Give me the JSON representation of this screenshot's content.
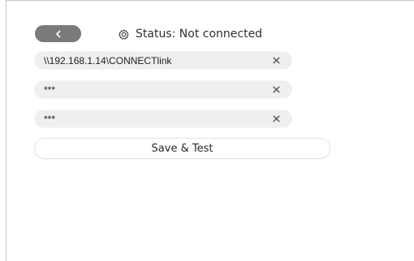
{
  "header": {
    "back_icon": "chevron-left-icon",
    "status_icon": "gear-icon",
    "status_text": "Status: Not connected"
  },
  "fields": [
    {
      "value": "\\\\192.168.1.14\\CONNECTlink",
      "clear_icon": "close-icon"
    },
    {
      "value": "***",
      "clear_icon": "close-icon"
    },
    {
      "value": "***",
      "clear_icon": "close-icon"
    }
  ],
  "actions": {
    "save_label": "Save & Test"
  }
}
